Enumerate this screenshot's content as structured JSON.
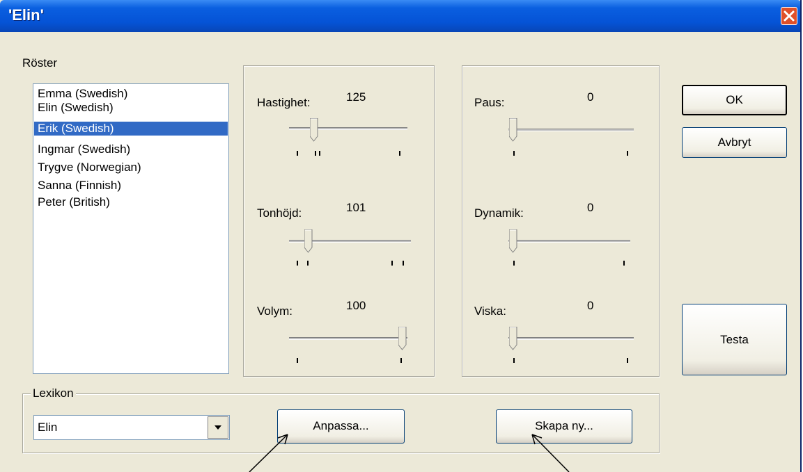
{
  "window": {
    "title": "'Elin'"
  },
  "voices": {
    "label": "Röster",
    "items": [
      {
        "label": "Emma (Swedish)",
        "selected": false
      },
      {
        "label": "Elin (Swedish)",
        "selected": false
      },
      {
        "label": "Erik (Swedish)",
        "selected": true
      },
      {
        "label": "Ingmar (Swedish)",
        "selected": false
      },
      {
        "label": "Trygve (Norwegian)",
        "selected": false
      },
      {
        "label": "Sanna (Finnish)",
        "selected": false
      },
      {
        "label": "Peter (British)",
        "selected": false
      }
    ]
  },
  "speech": {
    "speed": {
      "label": "Hastighet:",
      "value": "125"
    },
    "pitch": {
      "label": "Tonhöjd:",
      "value": "101"
    },
    "volume": {
      "label": "Volym:",
      "value": "100"
    }
  },
  "effects": {
    "pause": {
      "label": "Paus:",
      "value": "0"
    },
    "dynamics": {
      "label": "Dynamik:",
      "value": "0"
    },
    "whisper": {
      "label": "Viska:",
      "value": "0"
    }
  },
  "lexicon": {
    "label": "Lexikon",
    "selected": "Elin",
    "adapt_label": "Anpassa...",
    "create_label": "Skapa ny..."
  },
  "buttons": {
    "ok": "OK",
    "cancel": "Avbryt",
    "test": "Testa"
  },
  "icons": {
    "close": "close-icon",
    "dropdown": "chevron-down-icon"
  },
  "colors": {
    "titlebar": "#0553d6",
    "selection": "#316ac5",
    "dialog": "#ece9d8"
  }
}
